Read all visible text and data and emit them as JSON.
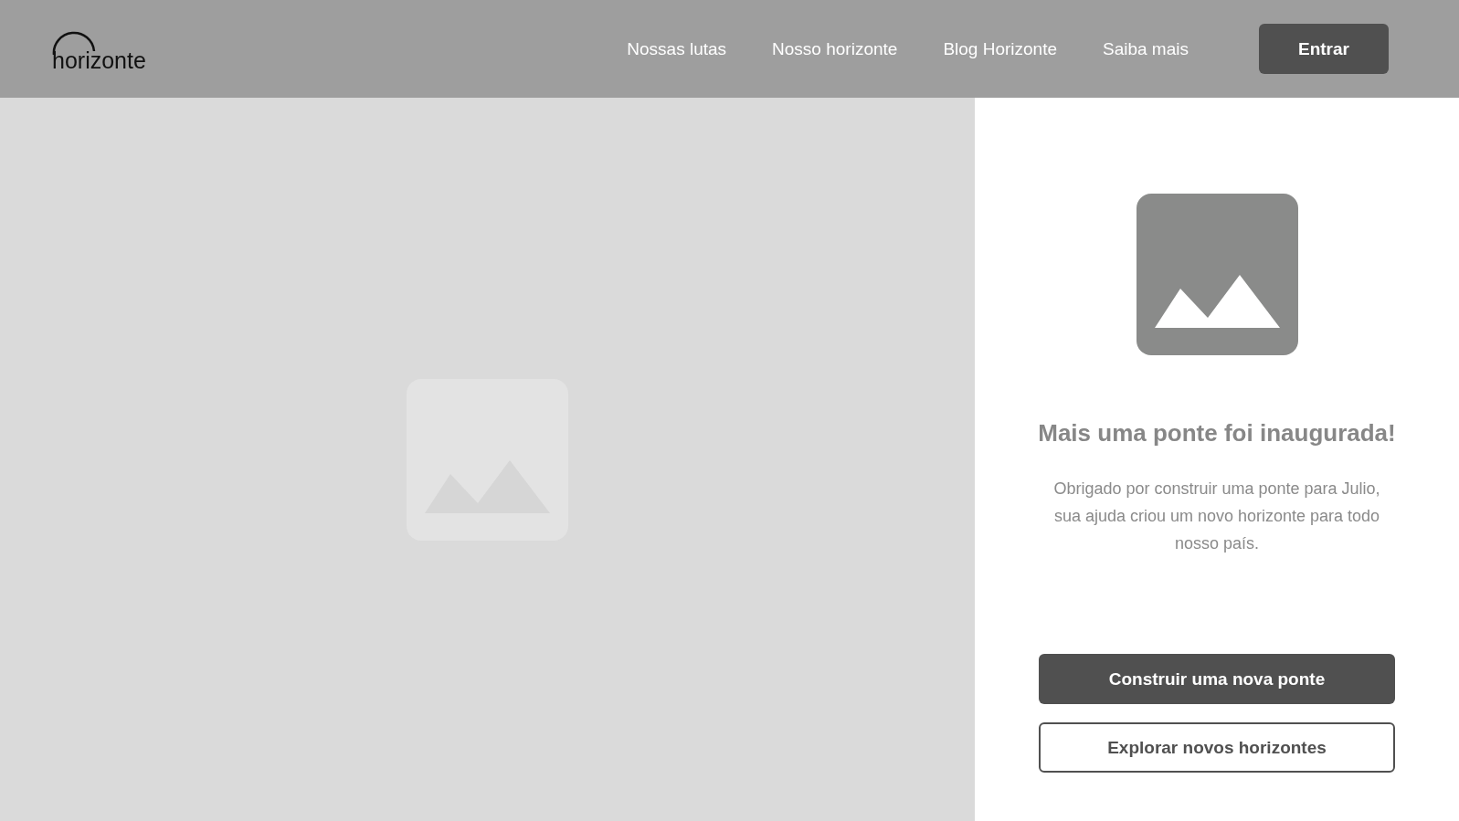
{
  "header": {
    "logo": "horizonte",
    "nav": [
      {
        "label": "Nossas lutas"
      },
      {
        "label": "Nosso horizonte"
      },
      {
        "label": "Blog Horizonte"
      },
      {
        "label": "Saiba mais"
      }
    ],
    "login": "Entrar"
  },
  "panel": {
    "title": "Mais uma ponte foi inaugurada!",
    "message": "Obrigado por construir uma ponte para Julio, sua ajuda criou um novo horizonte para todo nosso país.",
    "buttons": [
      {
        "label": "Construir uma nova ponte",
        "kind": "primary"
      },
      {
        "label": "Explorar novos horizontes",
        "kind": "outline"
      }
    ]
  }
}
